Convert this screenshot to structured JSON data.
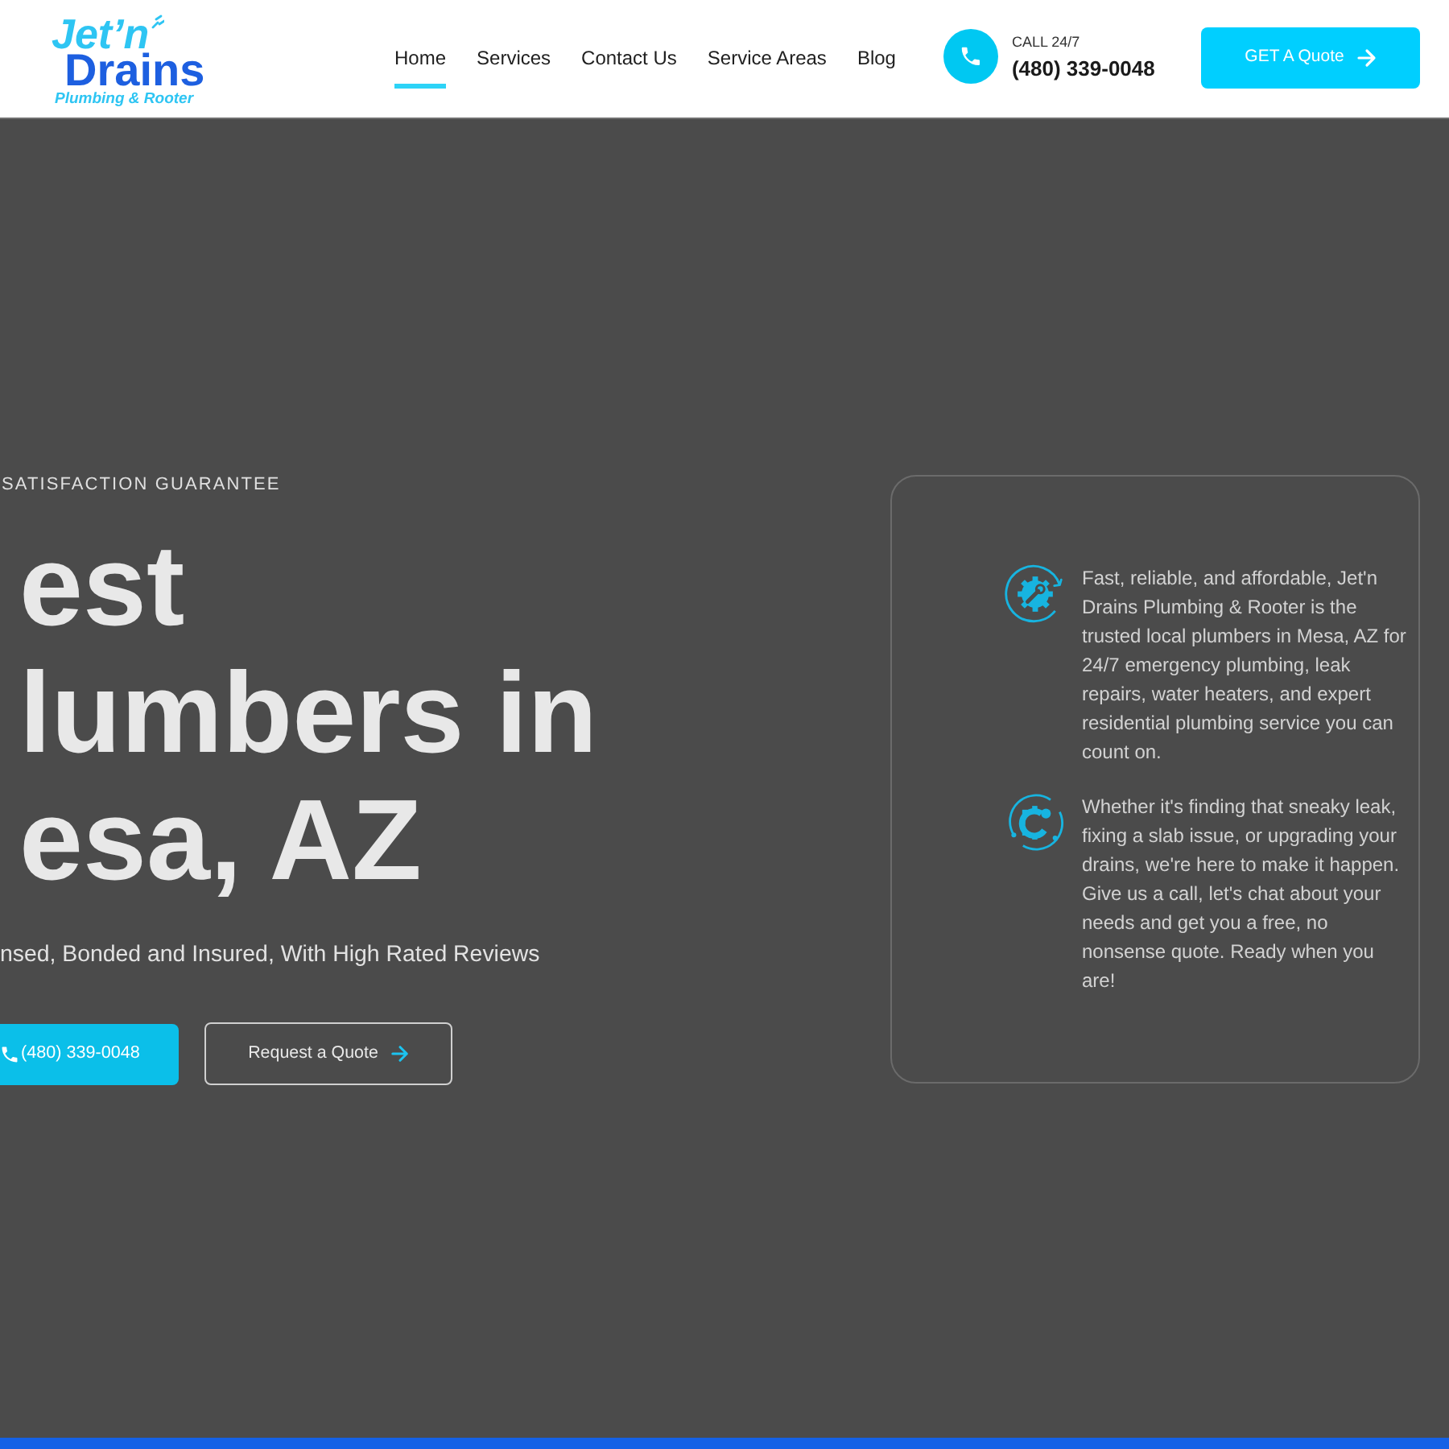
{
  "header": {
    "logo": {
      "name_top": "Jet’n",
      "name_bottom": "Drains",
      "tagline": "Plumbing & Rooter"
    },
    "nav": [
      {
        "label": "Home",
        "selected": true
      },
      {
        "label": "Services",
        "selected": false
      },
      {
        "label": "Contact Us",
        "selected": false
      },
      {
        "label": "Service Areas",
        "selected": false
      },
      {
        "label": "Blog",
        "selected": false
      }
    ],
    "call": {
      "label": "CALL 24/7",
      "phone": "(480) 339-0048"
    },
    "quote_button": {
      "label": "GET A Quote"
    }
  },
  "hero": {
    "eyebrow": "SATISFACTION GUARANTEE",
    "heading_lines": [
      "est",
      "lumbers in",
      "esa, AZ"
    ],
    "subtitle": "nsed, Bonded and Insured, With High Rated Reviews",
    "buttons": [
      {
        "kind": "phone",
        "label": "(480) 339-0048"
      },
      {
        "kind": "outline",
        "label": "Request a Quote"
      }
    ]
  },
  "card": {
    "features": [
      {
        "kind": "wrench",
        "text": "Fast, reliable, and affordable, Jet'n Drains Plumbing & Rooter is the trusted local plumbers in Mesa, AZ for 24/7 emergency plumbing, leak repairs, water heaters, and expert residential plumbing service you can count on."
      },
      {
        "kind": "gear",
        "text": "Whether it's finding that sneaky leak, fixing a slab issue, or upgrading your drains, we're here to make it happen. Give us a call, let's chat about your needs and get you a free, no nonsense quote. Ready when you are!"
      }
    ]
  }
}
